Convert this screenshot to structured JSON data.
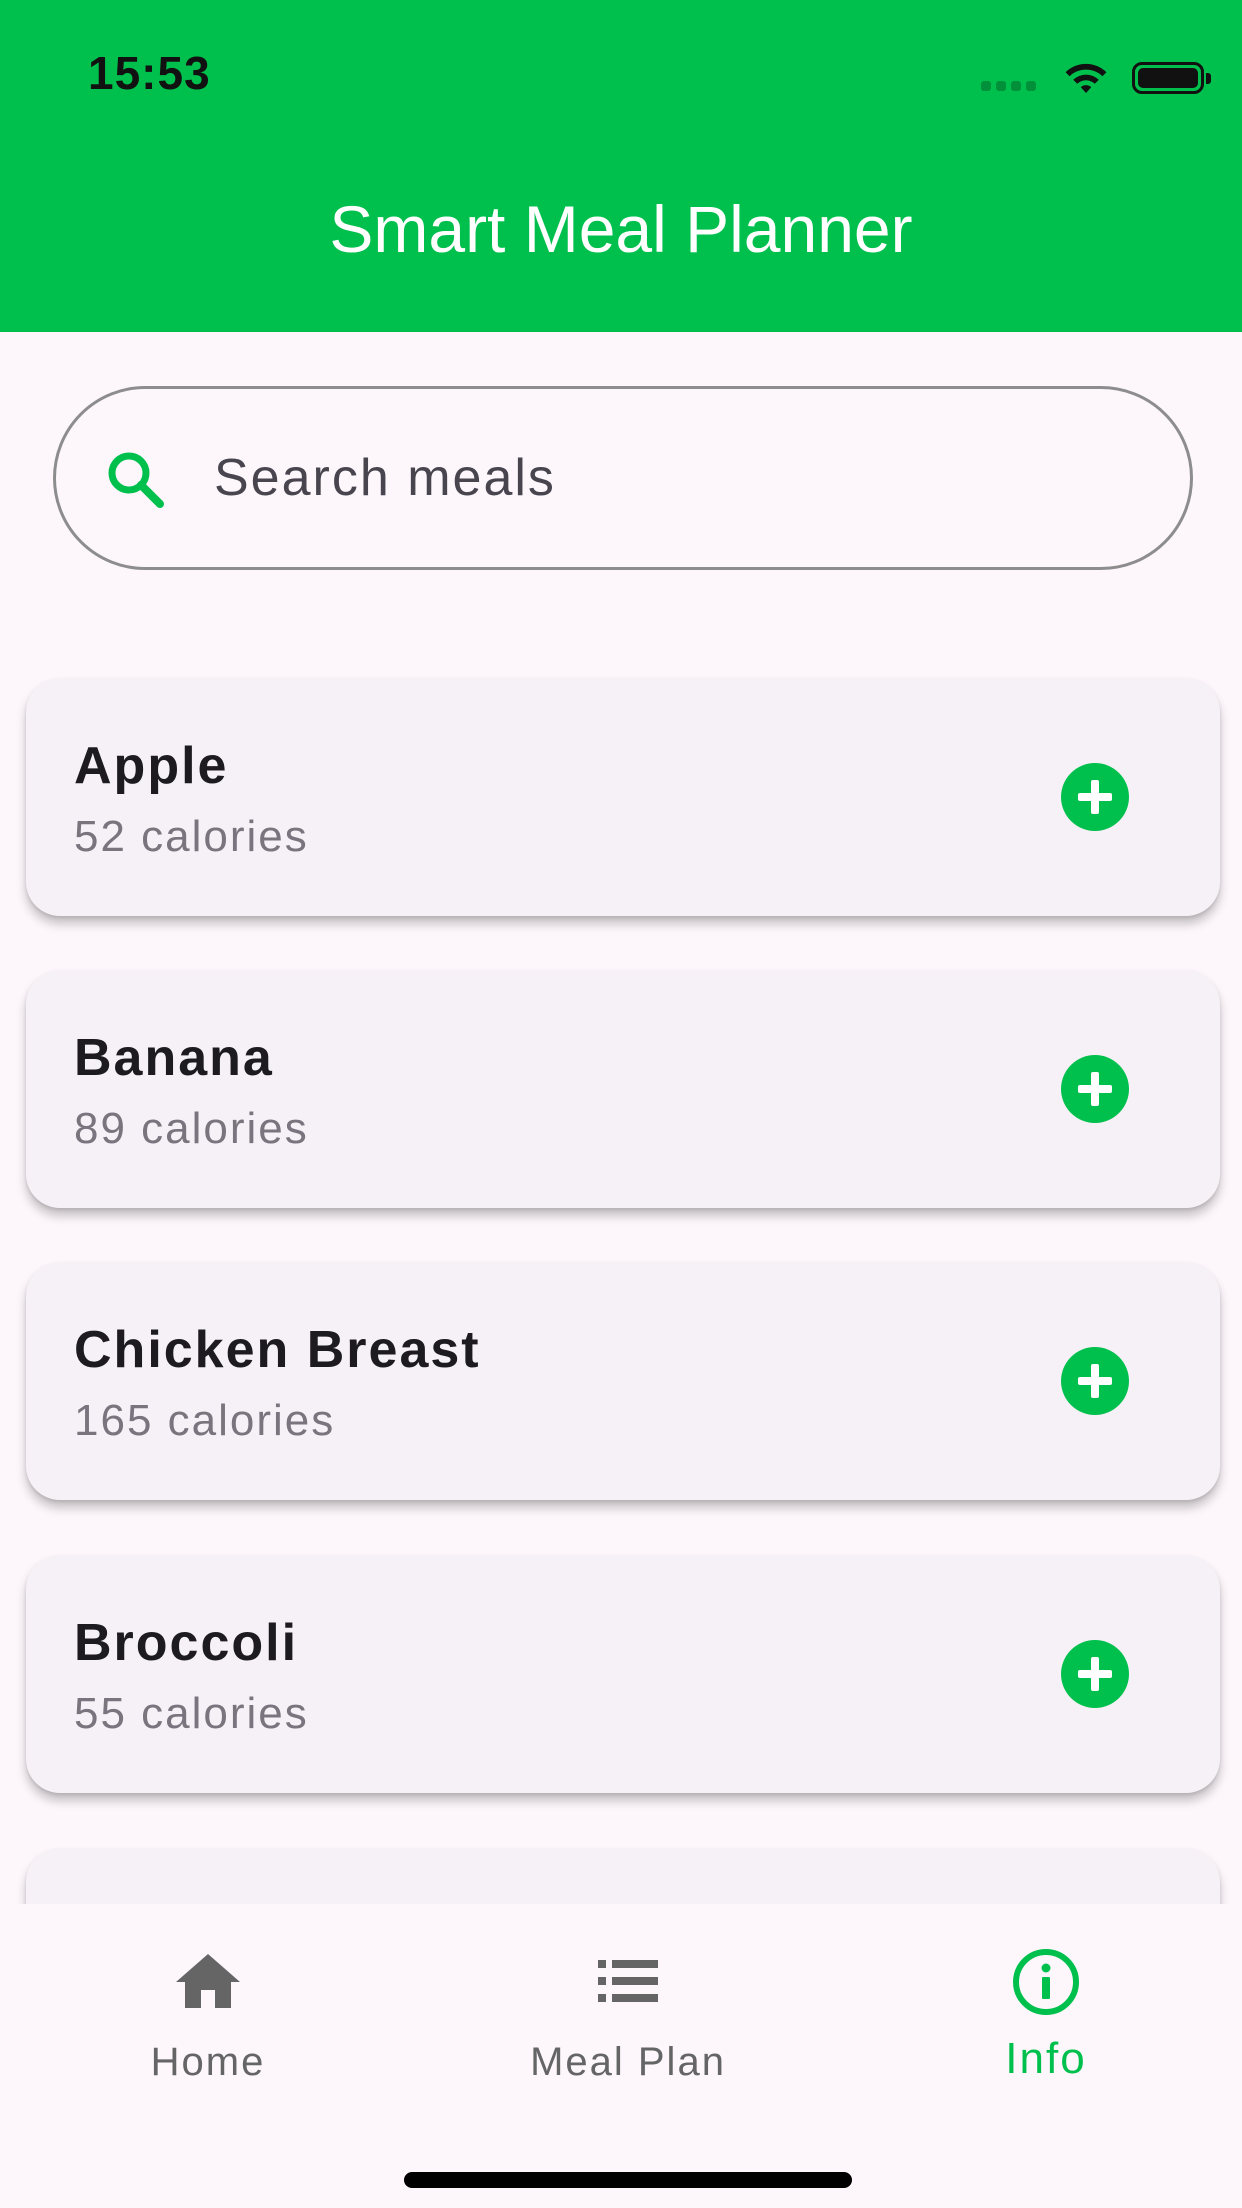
{
  "status_bar": {
    "time": "15:53"
  },
  "app_bar": {
    "title": "Smart Meal Planner",
    "color": "#00c04d"
  },
  "search": {
    "placeholder": "Search meals",
    "value": "",
    "icon": "search-icon"
  },
  "meals": [
    {
      "name": "Apple",
      "calories": "52 calories"
    },
    {
      "name": "Banana",
      "calories": "89 calories"
    },
    {
      "name": "Chicken Breast",
      "calories": "165 calories"
    },
    {
      "name": "Broccoli",
      "calories": "55 calories"
    }
  ],
  "bottom_nav": {
    "items": [
      {
        "label": "Home",
        "icon": "home-icon",
        "active": false
      },
      {
        "label": "Meal Plan",
        "icon": "list-icon",
        "active": false
      },
      {
        "label": "Info",
        "icon": "info-icon",
        "active": true
      }
    ]
  },
  "colors": {
    "accent": "#00c04d",
    "background": "#fdf7fc",
    "card": "#f6f1f6",
    "inactive_nav": "#656565"
  }
}
